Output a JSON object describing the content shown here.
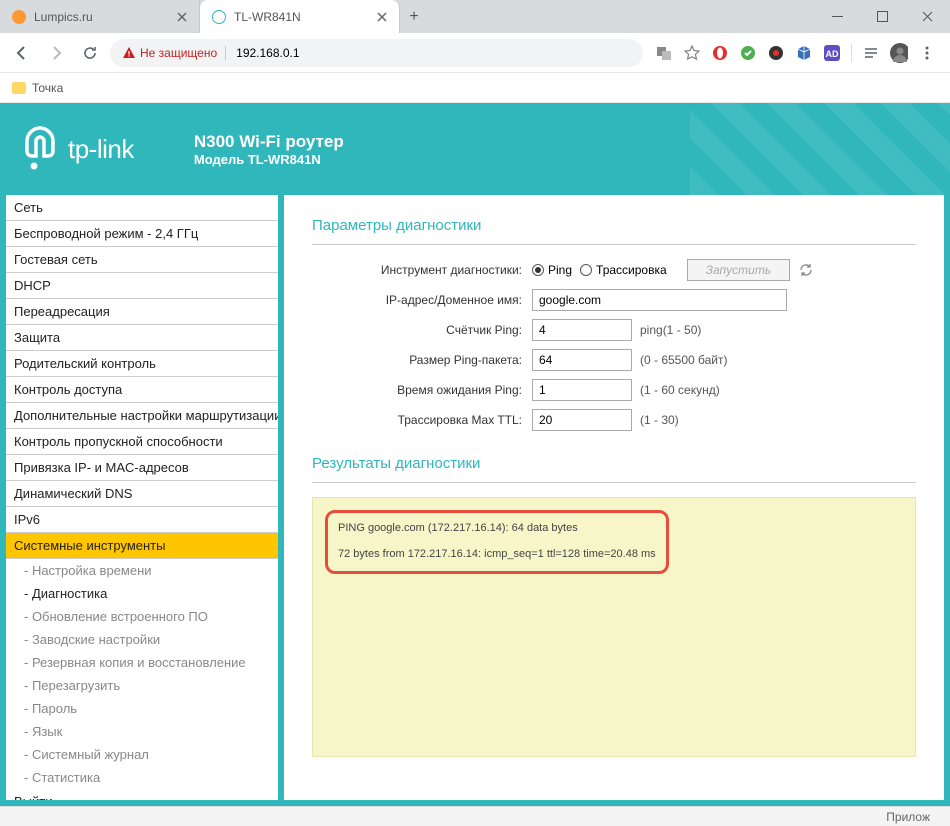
{
  "tabs": [
    {
      "title": "Lumpics.ru",
      "favcolor": "#ff9933",
      "active": false
    },
    {
      "title": "TL-WR841N",
      "favcolor": "#30b7bc",
      "active": true
    }
  ],
  "address": {
    "warning": "Не защищено",
    "url": "192.168.0.1"
  },
  "bookmark": "Точка",
  "header": {
    "brand": "tp-link",
    "title": "N300 Wi-Fi роутер",
    "model": "Модель TL-WR841N"
  },
  "sidebar": {
    "items": [
      "Сеть",
      "Беспроводной режим - 2,4 ГГц",
      "Гостевая сеть",
      "DHCP",
      "Переадресация",
      "Защита",
      "Родительский контроль",
      "Контроль доступа",
      "Дополнительные настройки маршрутизации",
      "Контроль пропускной способности",
      "Привязка IP- и MAC-адресов",
      "Динамический DNS",
      "IPv6",
      "Системные инструменты"
    ],
    "subs": [
      "- Настройка времени",
      "- Диагностика",
      "- Обновление встроенного ПО",
      "- Заводские настройки",
      "- Резервная копия и восстановление",
      "- Перезагрузить",
      "- Пароль",
      "- Язык",
      "- Системный журнал",
      "- Статистика"
    ],
    "last": "Выйти",
    "selected_main": 13,
    "selected_sub": 1
  },
  "diag": {
    "section_params": "Параметры диагностики",
    "tool_label": "Инструмент диагностики:",
    "radio_ping": "Ping",
    "radio_trace": "Трассировка",
    "btn_start": "Запустить",
    "ip_label": "IP-адрес/Доменное имя:",
    "ip_value": "google.com",
    "count_label": "Счётчик Ping:",
    "count_value": "4",
    "count_hint": "ping(1 - 50)",
    "size_label": "Размер Ping-пакета:",
    "size_value": "64",
    "size_hint": "(0 - 65500 байт)",
    "timeout_label": "Время ожидания Ping:",
    "timeout_value": "1",
    "timeout_hint": "(1 - 60 секунд)",
    "ttl_label": "Трассировка Max TTL:",
    "ttl_value": "20",
    "ttl_hint": "(1 - 30)",
    "section_results": "Результаты диагностики",
    "result_line1": "PING google.com (172.217.16.14): 64 data bytes",
    "result_line2": "72 bytes from 172.217.16.14: icmp_seq=1 ttl=128 time=20.48 ms"
  },
  "bottom": "Прилож"
}
